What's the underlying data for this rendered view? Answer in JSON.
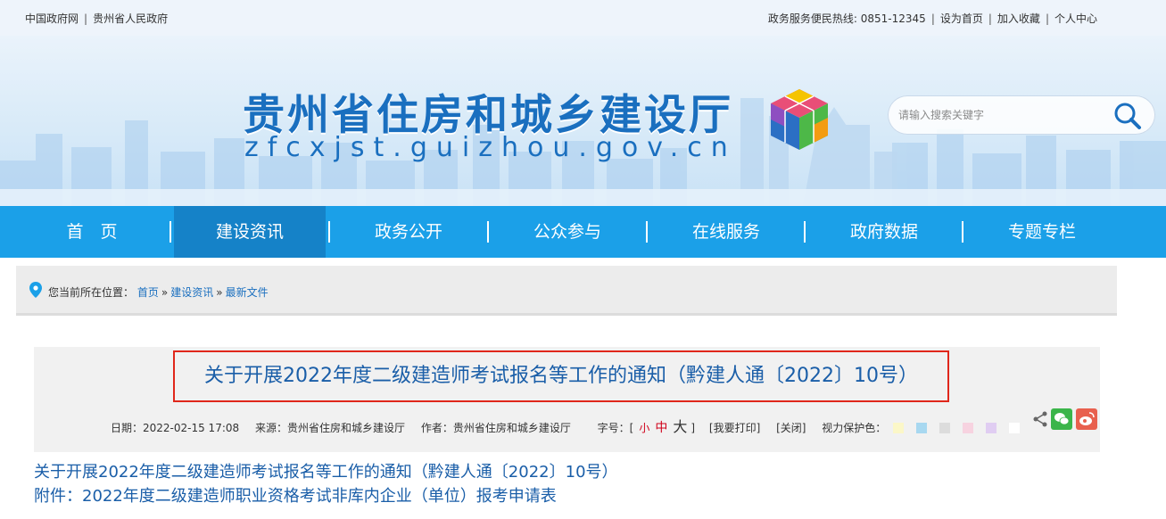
{
  "topbar": {
    "left_links": [
      "中国政府网",
      "贵州省人民政府"
    ],
    "hotline": "政务服务便民热线: 0851-12345",
    "right_links": [
      "设为首页",
      "加入收藏",
      "个人中心"
    ]
  },
  "banner": {
    "title": "贵州省住房和城乡建设厅",
    "url": "zfcxjst.guizhou.gov.cn",
    "search_placeholder": "请输入搜索关键字"
  },
  "nav": {
    "items": [
      "首　页",
      "建设资讯",
      "政务公开",
      "公众参与",
      "在线服务",
      "政府数据",
      "专题专栏"
    ],
    "active_index": 1
  },
  "breadcrumb": {
    "prefix": "您当前所在位置：",
    "items": [
      "首页",
      "建设资讯",
      "最新文件"
    ],
    "separator": "»"
  },
  "article": {
    "title": "关于开展2022年度二级建造师考试报名等工作的通知（黔建人通〔2022〕10号）",
    "date": "日期：2022-02-15 17:08",
    "source": "来源：贵州省住房和城乡建设厅",
    "author": "作者：贵州省住房和城乡建设厅",
    "font_size_label": "字号：[",
    "font_small": "小",
    "font_medium": "中",
    "font_large": "大",
    "font_close": "]",
    "print": "[我要打印]",
    "close": "[关闭]",
    "eye_label": "视力保护色：",
    "eye_colors": [
      "#fbf7c8",
      "#a8d8f0",
      "#dcdcdc",
      "#f7d3e0",
      "#e0cdf2",
      "#ffffff"
    ]
  },
  "links": [
    "关于开展2022年度二级建造师考试报名等工作的通知（黔建人通〔2022〕10号）",
    "附件：2022年度二级建造师职业资格考试非库内企业（单位）报考申请表"
  ],
  "colors": {
    "nav": "#1ba0e8",
    "nav_active": "#1582c8",
    "title_border": "#e0271b",
    "link": "#1a5ea8"
  }
}
